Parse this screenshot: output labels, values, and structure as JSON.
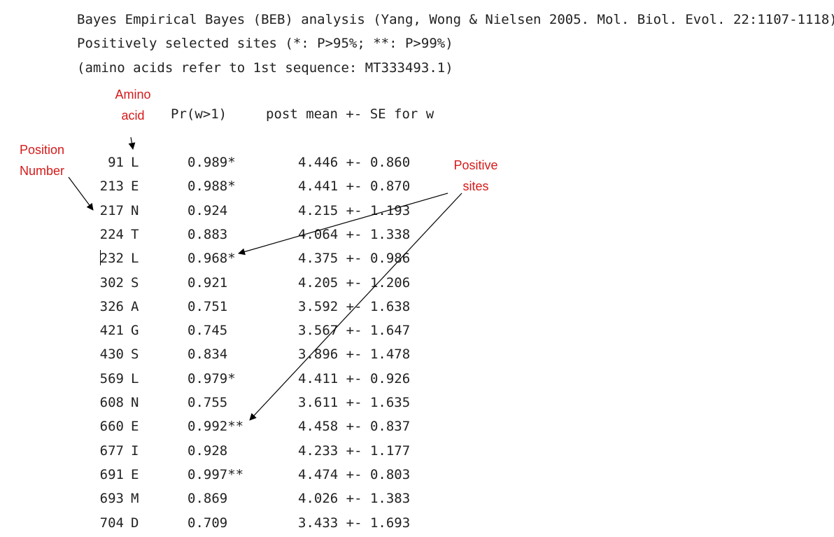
{
  "header": {
    "line1": "Bayes Empirical Bayes (BEB) analysis (Yang, Wong & Nielsen 2005. Mol. Biol. Evol. 22:1107-1118)",
    "line2": "Positively selected sites (*: P>95%; **: P>99%)",
    "line3": "(amino acids refer to 1st sequence: MT333493.1)"
  },
  "columns": {
    "pr": "Pr(w>1)",
    "post": "post mean +- SE for w"
  },
  "annotations": {
    "amino_line1": "Amino",
    "amino_line2": "acid",
    "position_line1": "Position",
    "position_line2": "Number",
    "positive_line1": "Positive",
    "positive_line2": "sites"
  },
  "sites": [
    {
      "pos": "91",
      "aa": "L",
      "pr": "0.989*",
      "mean": "4.446",
      "se": "0.860"
    },
    {
      "pos": "213",
      "aa": "E",
      "pr": "0.988*",
      "mean": "4.441",
      "se": "0.870"
    },
    {
      "pos": "217",
      "aa": "N",
      "pr": "0.924",
      "mean": "4.215",
      "se": "1.193"
    },
    {
      "pos": "224",
      "aa": "T",
      "pr": "0.883",
      "mean": "4.064",
      "se": "1.338"
    },
    {
      "pos": "232",
      "aa": "L",
      "pr": "0.968*",
      "mean": "4.375",
      "se": "0.986"
    },
    {
      "pos": "302",
      "aa": "S",
      "pr": "0.921",
      "mean": "4.205",
      "se": "1.206"
    },
    {
      "pos": "326",
      "aa": "A",
      "pr": "0.751",
      "mean": "3.592",
      "se": "1.638"
    },
    {
      "pos": "421",
      "aa": "G",
      "pr": "0.745",
      "mean": "3.567",
      "se": "1.647"
    },
    {
      "pos": "430",
      "aa": "S",
      "pr": "0.834",
      "mean": "3.896",
      "se": "1.478"
    },
    {
      "pos": "569",
      "aa": "L",
      "pr": "0.979*",
      "mean": "4.411",
      "se": "0.926"
    },
    {
      "pos": "608",
      "aa": "N",
      "pr": "0.755",
      "mean": "3.611",
      "se": "1.635"
    },
    {
      "pos": "660",
      "aa": "E",
      "pr": "0.992**",
      "mean": "4.458",
      "se": "0.837"
    },
    {
      "pos": "677",
      "aa": "I",
      "pr": "0.928",
      "mean": "4.233",
      "se": "1.177"
    },
    {
      "pos": "691",
      "aa": "E",
      "pr": "0.997**",
      "mean": "4.474",
      "se": "0.803"
    },
    {
      "pos": "693",
      "aa": "M",
      "pr": "0.869",
      "mean": "4.026",
      "se": "1.383"
    },
    {
      "pos": "704",
      "aa": "D",
      "pr": "0.709",
      "mean": "3.433",
      "se": "1.693"
    }
  ],
  "colors": {
    "annotation": "#d61a1a",
    "text": "#222222",
    "arrow": "#000000"
  }
}
